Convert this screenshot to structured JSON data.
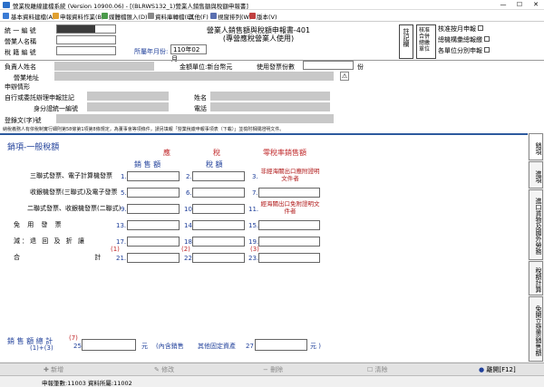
{
  "window": {
    "title": "營業稅離線建檔系統 (Version 10900.06) - [(BLRWS132_1)營業人銷售額與稅額申報書]",
    "minimize": "—",
    "maximize": "☐",
    "close": "✕"
  },
  "menu": {
    "items": [
      "基本資料建檔(A)",
      "申報資料作業(B)",
      "媒體檔匯入(D)",
      "資料庫轉檔(E)",
      "其他(F)",
      "視窗排列(W)",
      "版本(V)"
    ]
  },
  "header": {
    "tax_id_label": "統 一 編 號",
    "biz_name_label": "營業人名稱",
    "tax_reg_label": "稅 籍 編 號",
    "form_title": "營業人銷售額與稅額申報書-401",
    "form_subtitle": "(專營應稅營業人使用)",
    "period_label": "所屬年月份:",
    "period_value": "110年02月",
    "register_mark": "註記欄",
    "check_items": [
      "核准按月申報",
      "總機構彙總報繳",
      "各單位分別申報"
    ],
    "check_group_label": "核准合併總繳單位",
    "owner_label": "負責人姓名",
    "currency_label": "金額單位:新台幣元",
    "invoice_count_label": "使用發票份數",
    "invoice_unit": "份",
    "address_label": "營業地址",
    "declarant_section": "申辦情形",
    "self_filing_label": "自行或委託辦理申報註記",
    "name_label": "姓名",
    "id_label": "身分證統一編號",
    "phone_label": "電話",
    "doc_no_label": "登錄文(字)號",
    "notice": "納稅義務人有依稅制實行細則第58條第1項第8條規定，為董事會等項條件，請另填報「營業稅繳申報事項表（下載）」並檢附相關證明文件。"
  },
  "form": {
    "section_title": "銷項-一般稅額",
    "col_taxable": "應",
    "col_tax": "稅",
    "col_zero": "零稅率銷售額",
    "col_sales": "銷 售 額",
    "col_taxamt": "稅 額",
    "rows": [
      {
        "label": "三聯式發票、電子計算機發票",
        "n1": "1.",
        "n2": "2."
      },
      {
        "label": "收銀機發票(三聯式)及電子發票",
        "n1": "5.",
        "n2": "6."
      },
      {
        "label": "二聯式發票、收銀機發票(二聯式)",
        "n1": "9.",
        "n2": "10."
      },
      {
        "label": "免 用 發 票",
        "n1": "13.",
        "n2": "14."
      },
      {
        "label": "減：退 回 及 折 讓",
        "n1": "17.",
        "n2": "18."
      },
      {
        "label": "合 計",
        "n1": "21.",
        "n2": "22."
      }
    ],
    "zero_note1": "非經海關出口應附證明文件者",
    "zero_n3": "3.",
    "zero_n7": "7.",
    "zero_note2": "經海關出口免附證明文件者",
    "zero_n11": "11.",
    "zero_n15": "15.",
    "zero_n19": "19.",
    "zero_n23": "23.",
    "sub1": "(1)",
    "sub2": "(2)",
    "sub3": "(3)",
    "total_label": "銷 售 額 總 計",
    "total_formula": "(1)+(3)",
    "total_sub": "(7)",
    "n25": "25",
    "unit_yuan": "元",
    "include_note": "(內含銷售",
    "fixed_assets": "其他固定資產",
    "n27": "27",
    "unit_yuan_close": "元 )"
  },
  "sidetabs": [
    "銷項",
    "進項",
    "進口貨物及國外勞務",
    "稅額計算",
    "免開立發票銷售額"
  ],
  "toolbar": {
    "add": "新增",
    "edit": "修改",
    "delete": "刪除",
    "clear": "清除",
    "exit": "離開[F12]"
  },
  "status": "申報筆數:11003 資料所屬:11002",
  "colors": {
    "accent": "#2d5a9e",
    "label_blue": "#1f3f9a",
    "red": "#c0282a"
  }
}
